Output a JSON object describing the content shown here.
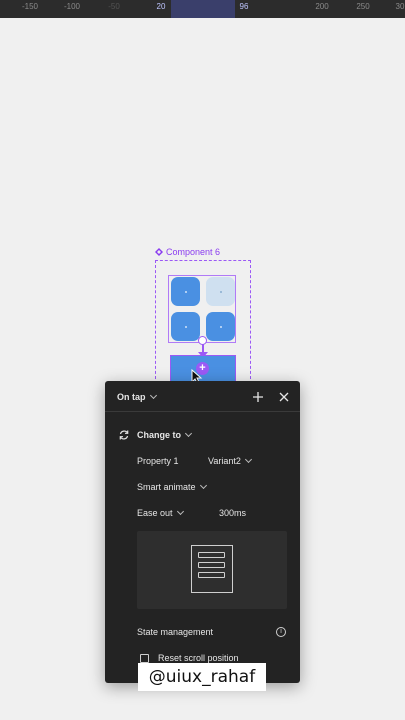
{
  "ruler": {
    "ticks": [
      "-150",
      "-100",
      "-50",
      "20",
      "96",
      "200",
      "250",
      "30"
    ]
  },
  "canvas": {
    "component_label": "Component 6",
    "accent_color": "#9b59f5",
    "tile_color": "#4a90e2"
  },
  "panel": {
    "trigger": "On tap",
    "action": "Change to",
    "property_label": "Property 1",
    "property_value": "Variant2",
    "animation": "Smart animate",
    "easing": "Ease out",
    "duration": "300ms",
    "state_management": "State management",
    "reset_scroll": "Reset scroll position",
    "icons": [
      "plus-icon",
      "close-icon",
      "swap-icon",
      "info-icon"
    ]
  },
  "watermark": "@uiux_rahaf"
}
